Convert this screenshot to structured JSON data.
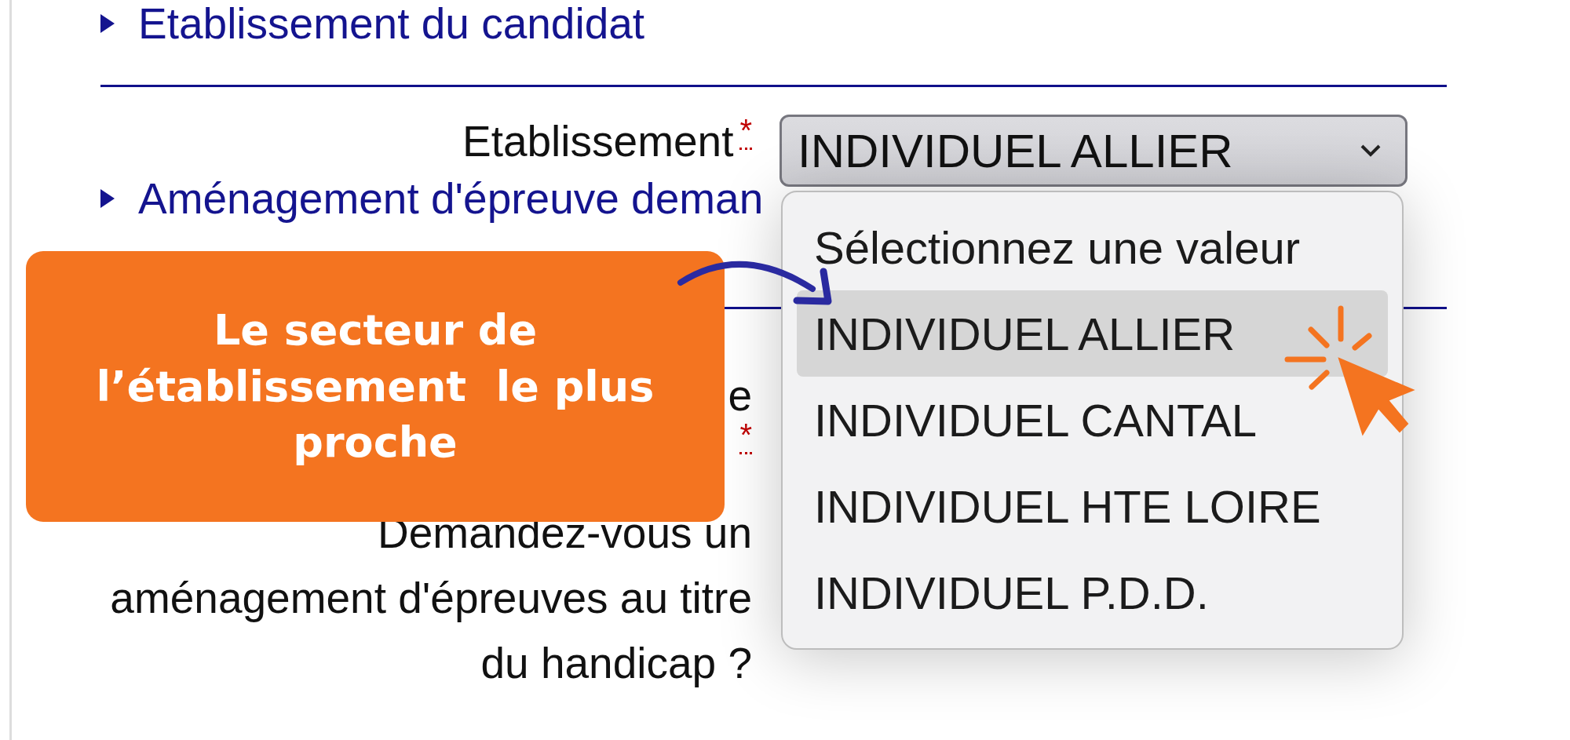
{
  "sections": [
    {
      "title": "Etablissement du candidat",
      "fields": [
        {
          "kind": "select",
          "label": "Etablissement",
          "required_mark": "*",
          "value": "INDIVIDUEL ALLIER"
        }
      ]
    },
    {
      "title": "Aménagement d'épreuve deman",
      "fields": [
        {
          "kind": "stacked",
          "label": "e",
          "required_mark": "*"
        },
        {
          "kind": "question",
          "label": "Demandez-vous un aménagement d'épreuves au titre du handicap ?"
        }
      ]
    }
  ],
  "dropdown": {
    "options": [
      {
        "label": "Sélectionnez une valeur",
        "selected": false
      },
      {
        "label": "INDIVIDUEL ALLIER",
        "selected": true
      },
      {
        "label": "INDIVIDUEL CANTAL",
        "selected": false
      },
      {
        "label": "INDIVIDUEL HTE LOIRE",
        "selected": false
      },
      {
        "label": "INDIVIDUEL P.D.D.",
        "selected": false
      }
    ]
  },
  "callout": {
    "text": "Le secteur de\nl’établissement  le plus\nproche"
  }
}
